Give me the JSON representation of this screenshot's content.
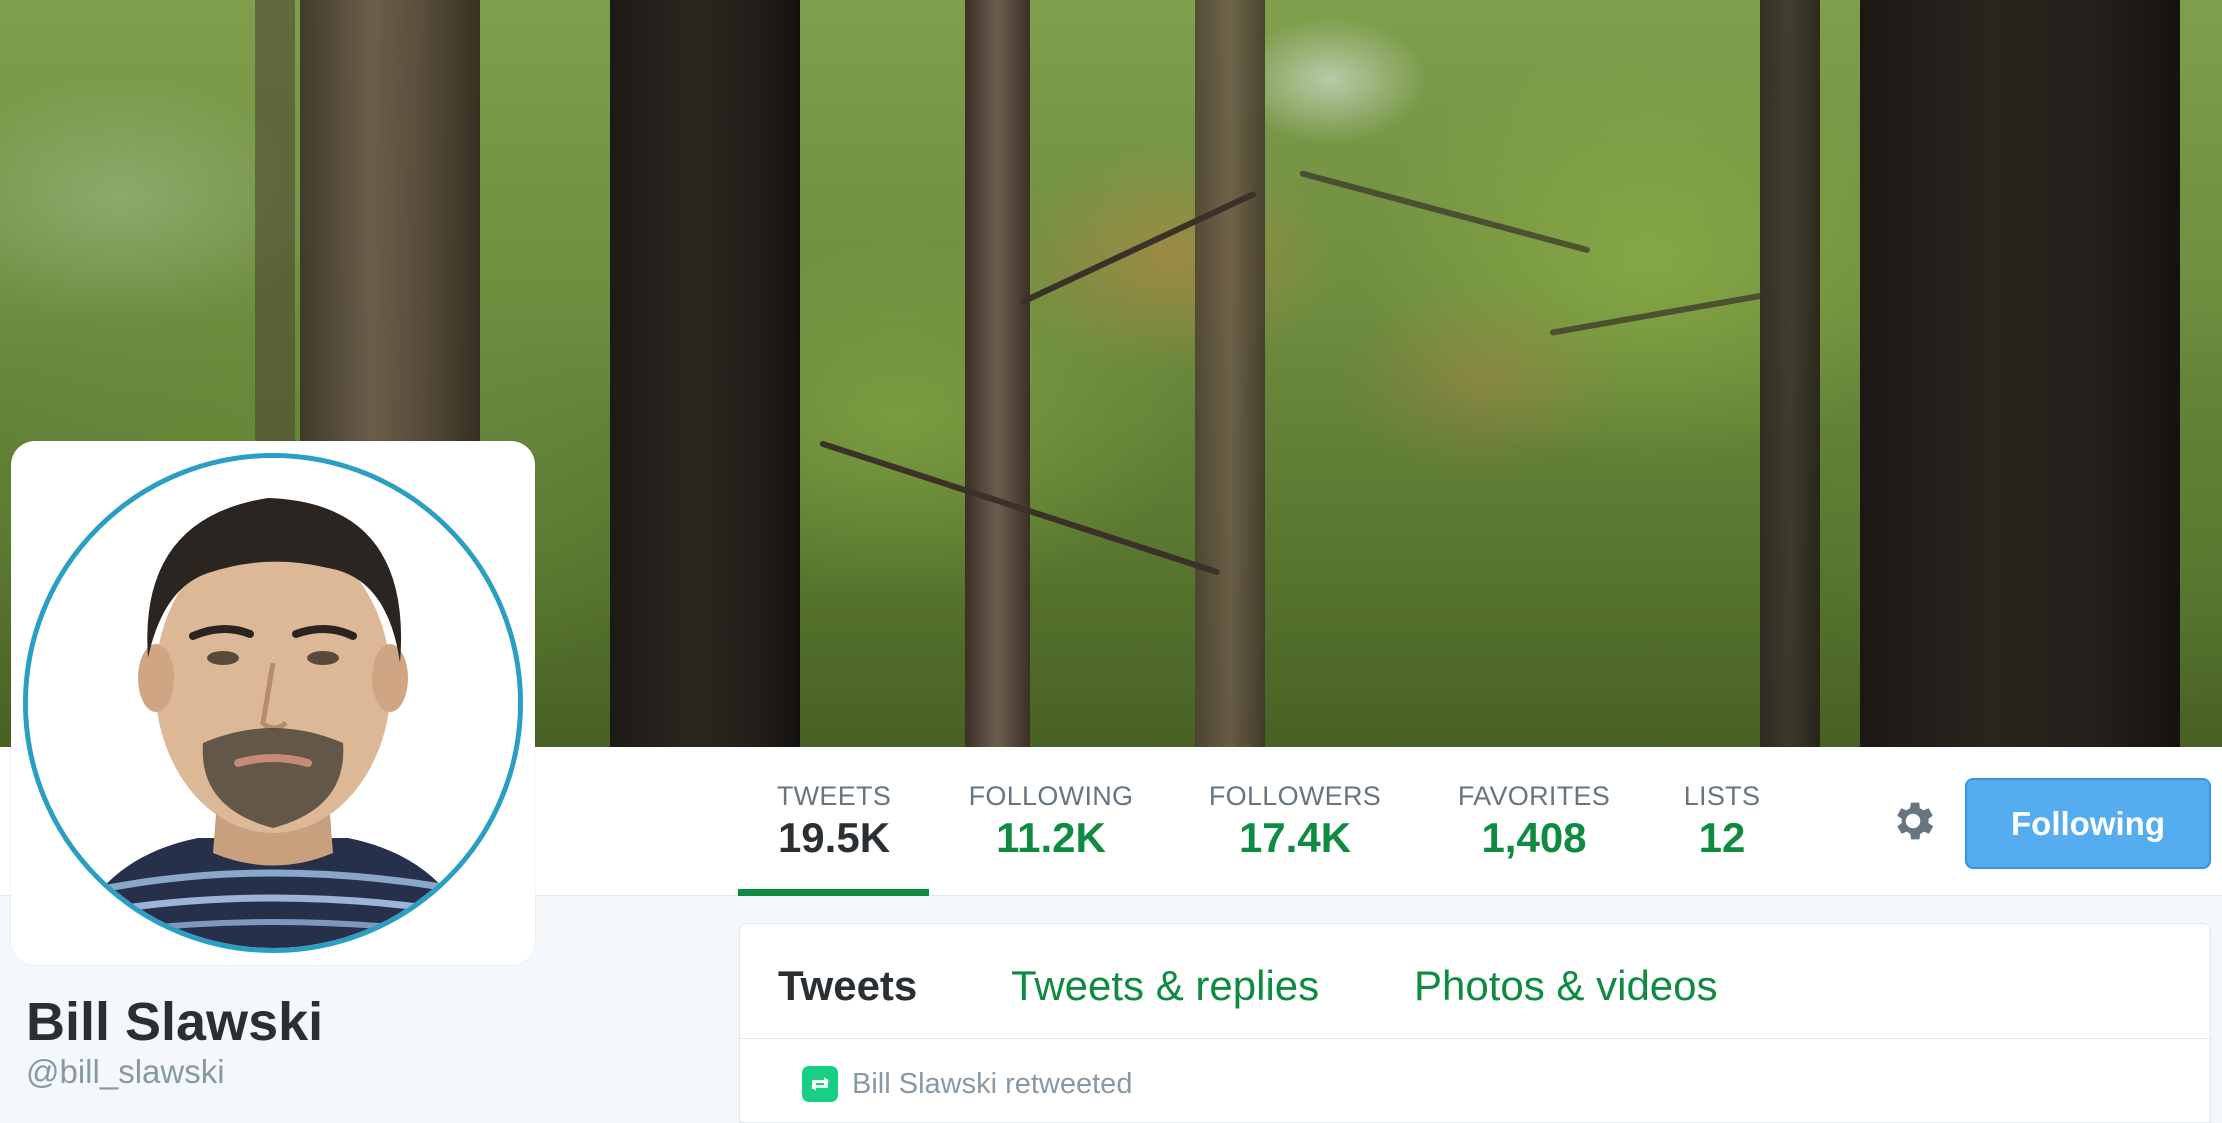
{
  "profile": {
    "name": "Bill Slawski",
    "handle": "@bill_slawski"
  },
  "stats": [
    {
      "label": "TWEETS",
      "value": "19.5K"
    },
    {
      "label": "FOLLOWING",
      "value": "11.2K"
    },
    {
      "label": "FOLLOWERS",
      "value": "17.4K"
    },
    {
      "label": "FAVORITES",
      "value": "1,408"
    },
    {
      "label": "LISTS",
      "value": "12"
    }
  ],
  "actions": {
    "follow_button_label": "Following",
    "settings_icon": "gear-icon"
  },
  "timeline": {
    "tabs": [
      {
        "label": "Tweets"
      },
      {
        "label": "Tweets & replies"
      },
      {
        "label": "Photos & videos"
      }
    ],
    "first_item": {
      "context_text": "Bill Slawski retweeted",
      "context_icon": "retweet-icon"
    }
  },
  "colors": {
    "accent_green": "#0f8a41",
    "button_blue": "#55acee",
    "avatar_ring": "#2b9ec4",
    "retweet_green": "#19cf86"
  }
}
